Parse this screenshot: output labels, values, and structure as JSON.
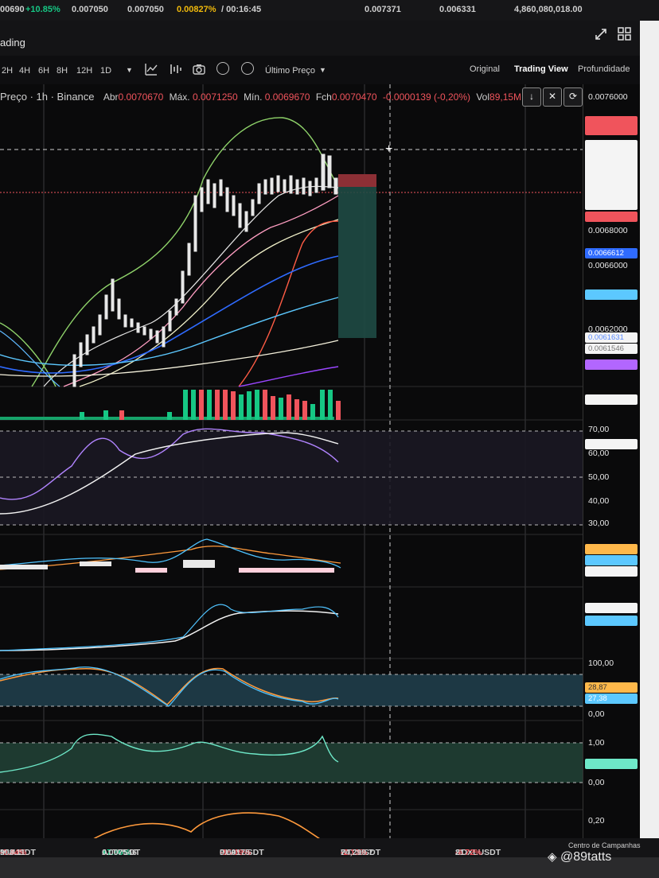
{
  "top_strip": {
    "change_prefix": "00690",
    "change_pct": "+10.85%",
    "v1": "0.007050",
    "v2": "0.007050",
    "v3": "0.00827%",
    "timer": "/ 00:16:45",
    "v4": "0.007371",
    "v5": "0.006331",
    "volume": "4,860,080,018.00"
  },
  "title_bar": {
    "title": "ading"
  },
  "toolbar": {
    "timeframes": [
      "2H",
      "4H",
      "6H",
      "8H",
      "12H",
      "1D"
    ],
    "price_type": "Último Preço",
    "views": [
      "Original",
      "Trading View",
      "Profundidade"
    ],
    "active_view": "Trading View"
  },
  "legend": {
    "symbol": "Preço · 1h · Binance",
    "open_label": "Abr",
    "open": "0.0070670",
    "high_label": "Máx.",
    "high": "0.0071250",
    "low_label": "Mín.",
    "low": "0.0069670",
    "close_label": "Fch",
    "close": "0.0070470",
    "change": "-0.0000139 (-0,20%)",
    "vol_label": "Vol",
    "vol": "89,15M"
  },
  "price_axis": {
    "ticks": [
      "0.0076000",
      "0.0068000",
      "0.0066000",
      "0.0062000"
    ],
    "tags": [
      "0.0066612",
      "0.0061631",
      "0.0061546"
    ],
    "rsi_ticks": [
      "70,00",
      "60,00",
      "50,00",
      "40,00",
      "30,00"
    ],
    "stoch_ticks": [
      "100,00",
      "0,00"
    ],
    "stoch_tags": [
      "28,87",
      "27,38"
    ],
    "osc_ticks": [
      "1,00",
      "0,00",
      "0,20"
    ]
  },
  "bottom_strip": [
    {
      "sym": "MUUSDT",
      "chg": "-0.44%",
      "price": "908.11",
      "dir": "down"
    },
    {
      "sym": "ALTUSDT",
      "chg": "+7.66%",
      "price": "0.007546",
      "dir": "up"
    },
    {
      "sym": "PLAYUSDT",
      "chg": "-15.19%",
      "price": "0.09175",
      "dir": "down"
    },
    {
      "sym": "BTCUSDT",
      "chg": "-2.13%",
      "price": "74,299.7",
      "dir": "down"
    },
    {
      "sym": "SOXLUSDT",
      "chg": "-6.72%",
      "price": "21",
      "dir": "down"
    }
  ],
  "campaign_center": "Centro de Campanhas",
  "watermark": "@89tatts",
  "colors": {
    "up": "#16c784",
    "down": "#f0545c",
    "blue_tag": "#2f6bff",
    "purple_tag": "#b266ff"
  }
}
